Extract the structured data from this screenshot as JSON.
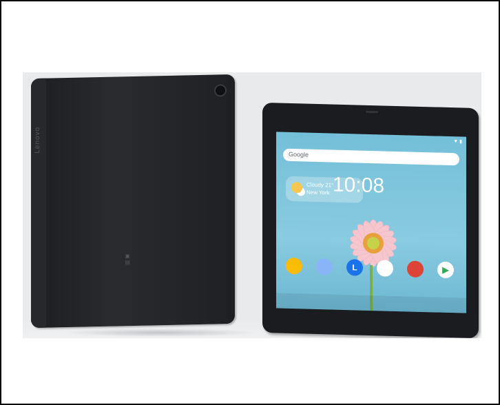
{
  "product_photo": {
    "back_brand": "Lenovo",
    "front_screen": {
      "search_label": "Google",
      "weather": {
        "condition": "Cloudy 21°",
        "city": "New York"
      },
      "time": "10:08",
      "apps": [
        {
          "icon": "photos-icon",
          "color": "#fbbc05"
        },
        {
          "icon": "duo-icon",
          "color": "#8ab4f8"
        },
        {
          "icon": "lenovo-l-icon",
          "label": "L",
          "color": "#1a73e8"
        },
        {
          "icon": "photos-pinwheel-icon",
          "color": "#ffffff"
        },
        {
          "icon": "chrome-icon",
          "color": "#db4437"
        },
        {
          "icon": "play-store-icon",
          "color": "#ffffff"
        }
      ]
    }
  }
}
